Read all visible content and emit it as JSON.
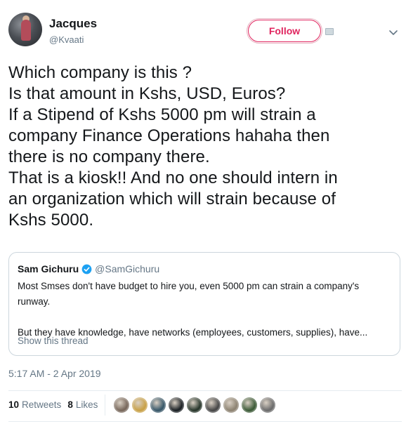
{
  "author": {
    "name": "Jacques",
    "handle": "@Kvaati",
    "avatar_icon": "profile-photo"
  },
  "header_actions": {
    "follow_label": "Follow",
    "follow_color": "#e0245e",
    "menu_icon": "chevron-down-icon"
  },
  "tweet": {
    "text": "Which company is this ?\nIs that amount in Kshs, USD, Euros?\nIf a Stipend of Kshs 5000 pm will strain a\ncompany Finance Operations hahaha then\nthere is no company there.\nThat is a kiosk!! And no one should intern in\nan organization which will strain because of\nKshs 5000.",
    "timestamp": "5:17 AM - 2 Apr 2019"
  },
  "quoted_tweet": {
    "name": "Sam Gichuru",
    "verified_icon": "verified-badge-icon",
    "verified_color": "#1da1f2",
    "handle": "@SamGichuru",
    "body": "Most Smses don't have budget to hire you, even 5000 pm can strain a company's\nrunway.\n\nBut they have knowledge, have networks (employees, customers, supplies), have...",
    "thread_link": "Show this thread"
  },
  "stats": {
    "retweets_count": "10",
    "retweets_label": "Retweets",
    "likes_count": "8",
    "likes_label": "Likes"
  },
  "likers": [
    {
      "icon": "liker-avatar",
      "color": "#7a6a5e"
    },
    {
      "icon": "liker-avatar",
      "color": "#c9a24a"
    },
    {
      "icon": "liker-avatar",
      "color": "#3b5a6b"
    },
    {
      "icon": "liker-avatar",
      "color": "#1f2428"
    },
    {
      "icon": "liker-avatar",
      "color": "#2c3a2f"
    },
    {
      "icon": "liker-avatar",
      "color": "#4a4a4a"
    },
    {
      "icon": "liker-avatar",
      "color": "#8f8574"
    },
    {
      "icon": "liker-avatar",
      "color": "#3f5d3a"
    },
    {
      "icon": "liker-avatar",
      "color": "#6e6e6e"
    }
  ]
}
